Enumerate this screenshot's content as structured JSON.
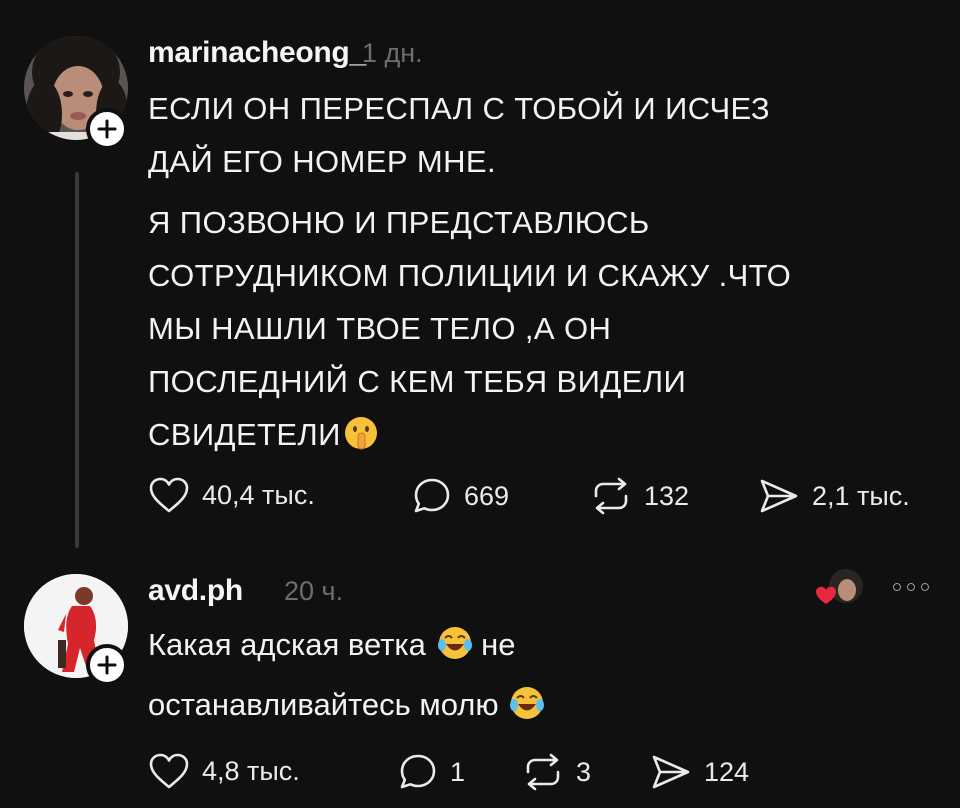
{
  "post": {
    "username": "marinacheong_",
    "time": "1 дн.",
    "text_lines": [
      "ЕСЛИ ОН ПЕРЕСПАЛ С ТОБОЙ И ИСЧЕЗ",
      "ДАЙ ЕГО НОМЕР МНЕ.",
      "Я ПОЗВОНЮ И ПРЕДСТАВЛЮСЬ",
      "СОТРУДНИКОМ ПОЛИЦИИ И СКАЖУ .ЧТО",
      "МЫ НАШЛИ ТВОЕ ТЕЛО ,А ОН",
      "ПОСЛЕДНИЙ С КЕМ ТЕБЯ ВИДЕЛИ",
      "СВИДЕТЕЛИ"
    ],
    "likes": "40,4 тыс.",
    "replies": "669",
    "reposts": "132",
    "shares": "2,1 тыс."
  },
  "reply": {
    "username": "avd.ph",
    "time": "20 ч.",
    "text_line1": "Какая адская ветка",
    "text_line1_end": "не",
    "text_line2": "останавливайтесь молю",
    "likes": "4,8 тыс.",
    "replies": "1",
    "reposts": "3",
    "shares": "124"
  },
  "icons": {
    "like": "heart-icon",
    "reply": "comment-icon",
    "repost": "repost-icon",
    "share": "send-icon",
    "follow": "plus-icon",
    "shush_emoji": "shushing-face-emoji",
    "laugh_emoji": "tears-of-joy-emoji",
    "more": "more-icon"
  },
  "colors": {
    "background": "#101010",
    "text": "#f3f3f3",
    "muted": "#6e6e6e",
    "heart_red": "#e8283f"
  }
}
